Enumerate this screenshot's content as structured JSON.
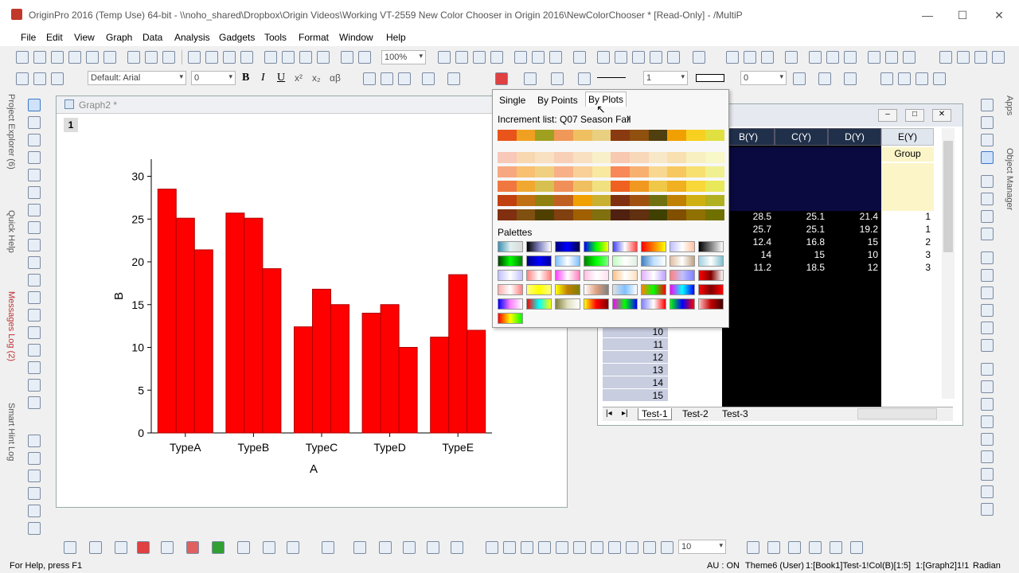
{
  "window": {
    "title": "OriginPro 2016 (Temp Use) 64-bit - \\\\noho_shared\\Dropbox\\Origin Videos\\Working VT-2559 New Color Chooser in Origin 2016\\NewColorChooser * [Read-Only] - /MultiP"
  },
  "menu": [
    "File",
    "Edit",
    "View",
    "Graph",
    "Data",
    "Analysis",
    "Gadgets",
    "Tools",
    "Format",
    "Window",
    "Help"
  ],
  "toolbar": {
    "zoom": "100%",
    "font": "Default: Arial",
    "font_size": "0",
    "bold": "B",
    "italic": "I",
    "underline": "U",
    "superscript": "x²",
    "subscript": "x₂",
    "greek": "αβ",
    "line_width": "1",
    "pattern_val": "0",
    "bottom_zoom": "10"
  },
  "left_tabs": [
    "Project Explorer (6)",
    "Quick Help",
    "Messages Log (2)",
    "Smart Hint Log"
  ],
  "right_tabs": [
    "Apps",
    "Object Manager"
  ],
  "graph": {
    "window_title": "Graph2 *",
    "layer": "1",
    "xlabel": "A",
    "ylabel": "B"
  },
  "chart_data": {
    "type": "bar",
    "categories": [
      "TypeA",
      "TypeB",
      "TypeC",
      "TypeD",
      "TypeE"
    ],
    "series": [
      {
        "values": [
          28.5,
          25.7,
          12.4,
          14,
          11.2
        ]
      },
      {
        "values": [
          25.1,
          25.1,
          16.8,
          15,
          18.5
        ]
      },
      {
        "values": [
          21.4,
          19.2,
          15,
          10,
          12
        ]
      }
    ],
    "ylim": [
      0,
      32
    ],
    "yticks": [
      0,
      5,
      10,
      15,
      20,
      25,
      30
    ],
    "xlabel": "A",
    "ylabel": "B",
    "bar_color": "#ff0000"
  },
  "popup": {
    "tabs": [
      "Single",
      "By Points",
      "By Plots"
    ],
    "active_tab": "By Plots",
    "increment_label": "Increment list: Q07 Season Fall",
    "palettes_label": "Palettes",
    "increment_colors": [
      "#e8541a",
      "#f0a020",
      "#a0a020",
      "#f09858",
      "#f0c060",
      "#e8d080",
      "#8a3a10",
      "#905010",
      "#504010",
      "#f0a000",
      "#f8d020",
      "#e0e040"
    ],
    "palette_rows": [
      [
        "#f8c8b8",
        "#f8d8b0",
        "#f8e0c0",
        "#f8d0b8",
        "#f8e0c0",
        "#f8f0c8",
        "#f8c8b0",
        "#f8d8b8",
        "#f8e8c8",
        "#f8e0b0",
        "#f8f0c0",
        "#f8f8c8"
      ],
      [
        "#f8a880",
        "#f8c070",
        "#f0d080",
        "#f8b088",
        "#f8d098",
        "#f8e8a0",
        "#f88858",
        "#f8b070",
        "#f8d890",
        "#f8c860",
        "#f8e070",
        "#f0f090"
      ],
      [
        "#f07840",
        "#f0a830",
        "#d8c050",
        "#f09058",
        "#f0c060",
        "#f0e080",
        "#f06020",
        "#f09820",
        "#f0c848",
        "#f0b020",
        "#f8d838",
        "#e8e858"
      ],
      [
        "#c04010",
        "#c07010",
        "#908010",
        "#c06020",
        "#f0a000",
        "#c8b030",
        "#803010",
        "#a05010",
        "#707010",
        "#c08000",
        "#d0b010",
        "#b0b020"
      ],
      [
        "#803010",
        "#805010",
        "#504000",
        "#804010",
        "#a06000",
        "#807010",
        "#502010",
        "#603010",
        "#404000",
        "#805000",
        "#907000",
        "#707000"
      ]
    ],
    "gradient_palettes": [
      [
        "#3a8fb0,#e0f0f0,#d8d8d8",
        "#000000,#8080c0,#ffffff",
        "#000080,#0000ff,#000040",
        "#0000ff,#00ff00,#ffff00",
        "#4040ff,#ffffff,#ff4040",
        "#ff0000,#ff8000,#ffff00",
        "#c0c0ff,#ffffff,#ffc0a0",
        "#000000,#808080,#ffffff"
      ],
      [
        "#004000,#00ff00,#008000",
        "#000080,#0000ff,#0000a0",
        "#80c0ff,#ffffff,#80c0ff",
        "#008000,#00ff00,#80ff80",
        "#c0ffc0,#ffffff,#e0f0e0",
        "#4080c0,#c0e0ff,#ffffff",
        "#e0c0a0,#ffffff,#c0a080",
        "#a0d0e0,#ffffff,#80c0d0"
      ],
      [
        "#c0c0ff,#ffffff,#c0c0ff",
        "#ff8080,#ffffff,#ff8080",
        "#ff40ff,#ffffff,#ff80c0",
        "#ffc0e0,#ffffff,#ffe0f0",
        "#ffc080,#ffffff,#ffe0c0",
        "#e0b0ff,#ffffff,#c0a0ff",
        "#ff8080,#c0c0ff,#8080ff",
        "#ff0000,#800000,#ffffff"
      ],
      [
        "#ffb0b0,#ffffff,#ff8080",
        "#ffff80,#ffff00,#ffff80",
        "#ffff00,#c08000,#808000",
        "#ffffff,#e0a080,#808080",
        "#e0e0e0,#80c0ff,#ffffff",
        "#ff8000,#00ff00,#ff0000",
        "#ff00ff,#00ffff,#0000ff",
        "#ff0000,#800000,#ff0000"
      ],
      [
        "#0000ff,#ff80ff,#ffffff",
        "#ff0000,#00ffff,#ffff00",
        "#808040,#e0e0c0,#ffffff",
        "#ffff00,#ff0000,#800000",
        "#ff00ff,#00ff00,#0000ff",
        "#8080ff,#ffffff,#ff0000",
        "#00ff00,#0000ff,#ff0000",
        "#ffc0c0,#c00000,#400000"
      ],
      [
        "#ff0000,#ffff00,#00ff00"
      ]
    ]
  },
  "workbook": {
    "columns": [
      "B(Y)",
      "C(Y)",
      "D(Y)",
      "E(Y)"
    ],
    "group_label": "Group",
    "rows": [
      [
        "28.5",
        "25.1",
        "21.4",
        "1"
      ],
      [
        "25.7",
        "25.1",
        "19.2",
        "1"
      ],
      [
        "12.4",
        "16.8",
        "15",
        "2"
      ],
      [
        "14",
        "15",
        "10",
        "3"
      ],
      [
        "11.2",
        "18.5",
        "12",
        "3"
      ]
    ],
    "row_numbers": [
      "10",
      "11",
      "12",
      "13",
      "14",
      "15"
    ],
    "sheets": [
      "Test-1",
      "Test-2",
      "Test-3"
    ]
  },
  "status": {
    "left": "For Help, press F1",
    "au": "AU : ON",
    "theme": "Theme6 (User)",
    "book": "1:[Book1]Test-1!Col(B)[1:5]",
    "graph": "1:[Graph2]1!1",
    "angle": "Radian"
  }
}
